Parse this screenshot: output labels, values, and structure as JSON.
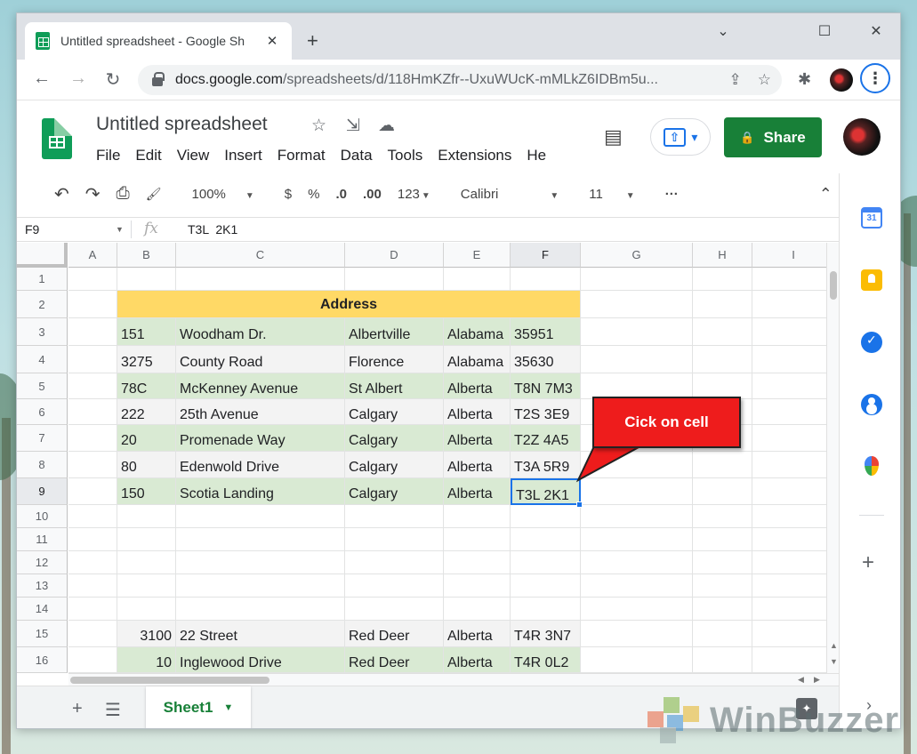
{
  "browser": {
    "tab_title": "Untitled spreadsheet - Google Sh",
    "tab_close": "✕",
    "new_tab": "+",
    "url_host": "docs.google.com",
    "url_path": "/spreadsheets/d/118HmKZfr--UxuWUcK-mMLkZ6IDBm5u...",
    "min": "⌄",
    "max": "☐",
    "close": "✕",
    "back": "←",
    "forward": "→",
    "reload": "↻",
    "share_icon": "⇪",
    "star_icon": "☆",
    "ext_icon": "✱",
    "menu": "⋮"
  },
  "sheets": {
    "title": "Untitled spreadsheet",
    "title_star": "☆",
    "title_move": "⇲",
    "title_cloud": "☁",
    "menu": [
      "File",
      "Edit",
      "View",
      "Insert",
      "Format",
      "Data",
      "Tools",
      "Extensions",
      "He"
    ],
    "comment_icon": "▤",
    "present_icon": "⇧",
    "present_caret": "▾",
    "share_lock": "🔒",
    "share_label": "Share"
  },
  "toolbar": {
    "undo": "↶",
    "redo": "↷",
    "print": "⎙",
    "paint": "🖌",
    "zoom": "100%",
    "currency": "$",
    "percent": "%",
    "dec_less": ".0",
    "dec_more": ".00",
    "more_formats": "123",
    "font": "Calibri",
    "font_size": "11",
    "more": "···",
    "collapse": "⌃",
    "caret": "▼"
  },
  "formula_bar": {
    "name_box": "F9",
    "fx": "fx",
    "value": "T3L  2K1"
  },
  "grid": {
    "columns": [
      "A",
      "B",
      "C",
      "D",
      "E",
      "F",
      "G",
      "H",
      "I"
    ],
    "rows": [
      "1",
      "2",
      "3",
      "4",
      "5",
      "6",
      "7",
      "8",
      "9",
      "10",
      "11",
      "12",
      "13",
      "14",
      "15",
      "16"
    ],
    "header_title": "Address",
    "data": [
      {
        "row": "3",
        "style": "green",
        "b": "151",
        "c": "Woodham Dr.",
        "d": "Albertville",
        "e": "Alabama",
        "f": "35951"
      },
      {
        "row": "4",
        "style": "gray",
        "b": "3275",
        "c": "County Road",
        "d": "Florence",
        "e": "Alabama",
        "f": "35630"
      },
      {
        "row": "5",
        "style": "green",
        "b": "78C",
        "c": "McKenney Avenue",
        "d": "St Albert",
        "e": "Alberta",
        "f": "T8N 7M3"
      },
      {
        "row": "6",
        "style": "gray",
        "b": "222",
        "c": "25th Avenue",
        "d": "Calgary",
        "e": "Alberta",
        "f": "T2S 3E9"
      },
      {
        "row": "7",
        "style": "green",
        "b": "20",
        "c": "Promenade Way",
        "d": "Calgary",
        "e": "Alberta",
        "f": "T2Z 4A5"
      },
      {
        "row": "8",
        "style": "gray",
        "b": "80",
        "c": "Edenwold Drive",
        "d": "Calgary",
        "e": "Alberta",
        "f": "T3A 5R9"
      },
      {
        "row": "9",
        "style": "green",
        "b": "150",
        "c": "Scotia Landing",
        "d": "Calgary",
        "e": "Alberta",
        "f": "T3L 2K1"
      },
      {
        "row": "15",
        "style": "gray",
        "b": "3100",
        "c": "22 Street",
        "d": "Red Deer",
        "e": "Alberta",
        "f": "T4R 3N7"
      },
      {
        "row": "16",
        "style": "green",
        "b": "10",
        "c": "Inglewood Drive",
        "d": "Red Deer",
        "e": "Alberta",
        "f": "T4R 0L2"
      }
    ],
    "selected_cell": "F9"
  },
  "sheet_tabs": {
    "add": "+",
    "list": "☰",
    "active": "Sheet1",
    "caret": "▼",
    "explore": "✦"
  },
  "side_panel": {
    "calendar": "31",
    "plus": "+",
    "expand": "›"
  },
  "callout": {
    "text": "Cick on cell"
  },
  "watermark": {
    "text": "WinBuzzer"
  }
}
